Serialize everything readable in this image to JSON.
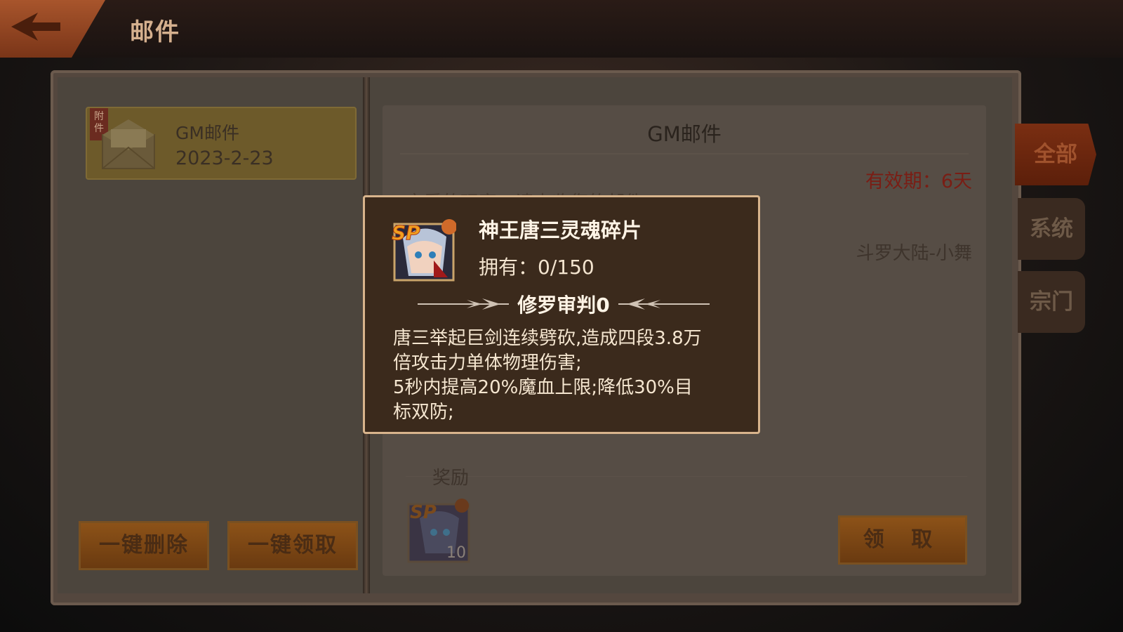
{
  "header": {
    "back_icon": "back-arrow-icon",
    "title": "邮件"
  },
  "mail_list": {
    "items": [
      {
        "attachment_tag": "附件",
        "title": "GM邮件",
        "date": "2023-2-23",
        "icon": "envelope-icon"
      }
    ]
  },
  "actions": {
    "delete_all": "一键删除",
    "claim_all": "一键领取"
  },
  "detail": {
    "title": "GM邮件",
    "validity_label": "有效期：",
    "validity_value": "6天",
    "body_fragment": "亲爱的玩家，请查收您的邮件!",
    "sender": "斗罗大陆-小舞",
    "reward_label": "奖励",
    "reward_count": "10",
    "claim_button": "领  取"
  },
  "tabs": [
    {
      "label": "全部",
      "active": true
    },
    {
      "label": "系统",
      "active": false
    },
    {
      "label": "宗门",
      "active": false
    }
  ],
  "tooltip": {
    "item_name": "神王唐三灵魂碎片",
    "owned_label": "拥有：",
    "owned_value": "0/150",
    "skill_name": "修罗审判0",
    "description": [
      "唐三举起巨剑连续劈砍,造成四段3.8万",
      "倍攻击力单体物理伤害;",
      "5秒内提高20%魔血上限;降低30%目",
      "标双防;"
    ],
    "badge": "SP"
  },
  "colors": {
    "accent_orange": "#c0661f",
    "validity_red": "#7a1d14",
    "popup_border": "#d8b48c",
    "popup_bg": "#3b2a1c"
  }
}
